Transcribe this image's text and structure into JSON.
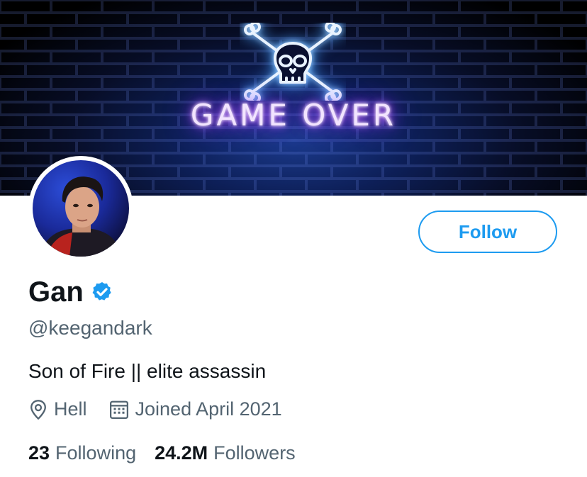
{
  "banner": {
    "text": "GAME OVER",
    "skull_icon": "skull-crossbones-icon"
  },
  "profile": {
    "avatar_icon": "profile-photo",
    "name": "Gan",
    "verified_icon": "verified-badge-icon",
    "handle": "@keegandark",
    "bio": "Son of Fire || elite assassin",
    "location": "Hell",
    "location_icon": "location-pin-icon",
    "joined": "Joined April 2021",
    "joined_icon": "calendar-icon"
  },
  "actions": {
    "follow_label": "Follow"
  },
  "stats": {
    "following_count": "23",
    "following_label": "Following",
    "followers_count": "24.2M",
    "followers_label": "Followers"
  },
  "colors": {
    "accent": "#1d9bf0",
    "text_primary": "#0f1419",
    "text_secondary": "#536471",
    "neon_glow": "#9d3cff"
  }
}
